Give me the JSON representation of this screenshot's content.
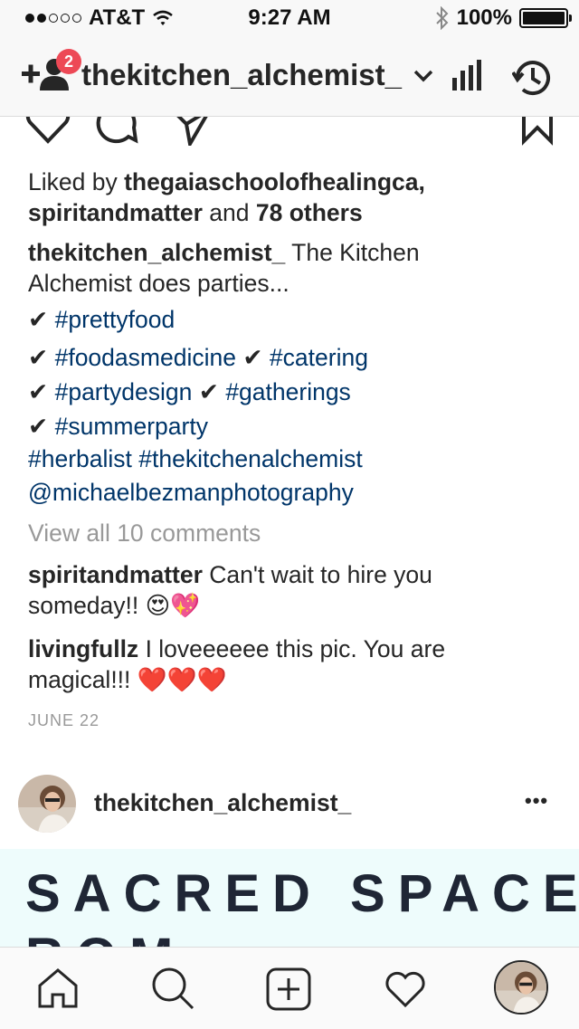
{
  "status_bar": {
    "carrier": "AT&T",
    "time": "9:27 AM",
    "battery": "100%"
  },
  "header": {
    "username": "thekitchen_alchemist_",
    "follow_requests_count": "2"
  },
  "post": {
    "liked_by_prefix": "Liked by",
    "liked_user_1": "thegaiaschoolofhealingca,",
    "liked_user_2": "spiritandmatter",
    "liked_and": "and",
    "liked_others": "78 others",
    "caption_user": "thekitchen_alchemist_",
    "caption_text_1": "The Kitchen",
    "caption_text_2": "Alchemist does parties...",
    "check": "✔",
    "tag_prettyfood": "#prettyfood",
    "tag_foodasmedicine": "#foodasmedicine",
    "tag_catering": "#catering",
    "tag_partydesign": "#partydesign",
    "tag_gatherings": "#gatherings",
    "tag_summerparty": "#summerparty",
    "tag_herbalist": "#herbalist",
    "tag_thekitchenalchemist": "#thekitchenalchemist",
    "mention": "@michaelbezmanphotography",
    "view_comments": "View all 10 comments",
    "comments": [
      {
        "user": "spiritandmatter",
        "text_1": "Can't wait to hire you",
        "text_2": "someday!!",
        "emoji": "😍💖"
      },
      {
        "user": "livingfullz",
        "text_1": "I loveeeeee this pic. You are",
        "text_2": "magical!!!",
        "emoji": "❤️❤️❤️"
      }
    ],
    "date": "JUNE 22"
  },
  "next_post": {
    "username": "thekitchen_alchemist_",
    "more": "•••",
    "banner_text": "SACRED SPACE",
    "banner_text_2": "ROM"
  },
  "tabs": {
    "home": "home-icon",
    "search": "search-icon",
    "add": "add-post-icon",
    "activity": "heart-icon",
    "profile": "profile-avatar"
  }
}
